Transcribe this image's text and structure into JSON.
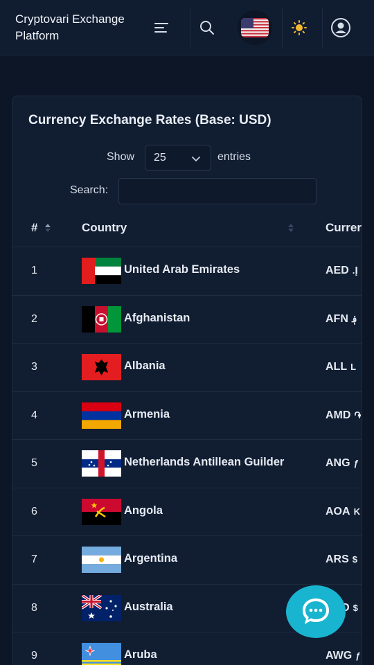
{
  "header": {
    "brand": "Cryptovari Exchange Platform",
    "menu_icon": "hamburger-menu-icon",
    "search_icon": "search-icon",
    "language_flag": "us-flag-icon",
    "theme_icon": "sun-icon",
    "account_icon": "user-circle-icon"
  },
  "panel": {
    "title": "Currency Exchange Rates (Base: USD)",
    "show_label": "Show",
    "entries_value": "25",
    "entries_label": "entries",
    "search_label": "Search:",
    "search_value": ""
  },
  "table": {
    "columns": [
      "#",
      "Country",
      "Currer"
    ],
    "rows": [
      {
        "num": "1",
        "country": "United Arab Emirates",
        "code": "AED",
        "symbol": ".إ"
      },
      {
        "num": "2",
        "country": "Afghanistan",
        "code": "AFN",
        "symbol": "؋"
      },
      {
        "num": "3",
        "country": "Albania",
        "code": "ALL",
        "symbol": "L"
      },
      {
        "num": "4",
        "country": "Armenia",
        "code": "AMD",
        "symbol": "֏"
      },
      {
        "num": "5",
        "country": "Netherlands Antillean Guilder",
        "code": "ANG",
        "symbol": "ƒ"
      },
      {
        "num": "6",
        "country": "Angola",
        "code": "AOA",
        "symbol": "K"
      },
      {
        "num": "7",
        "country": "Argentina",
        "code": "ARS",
        "symbol": "$"
      },
      {
        "num": "8",
        "country": "Australia",
        "code": "AUD",
        "symbol": "$"
      },
      {
        "num": "9",
        "country": "Aruba",
        "code": "AWG",
        "symbol": "ƒ"
      }
    ]
  },
  "chat": {
    "icon": "chat-bubble-icon"
  },
  "colors": {
    "background": "#0c1627",
    "panel": "#111d31",
    "chat_accent": "#19b4cf"
  }
}
